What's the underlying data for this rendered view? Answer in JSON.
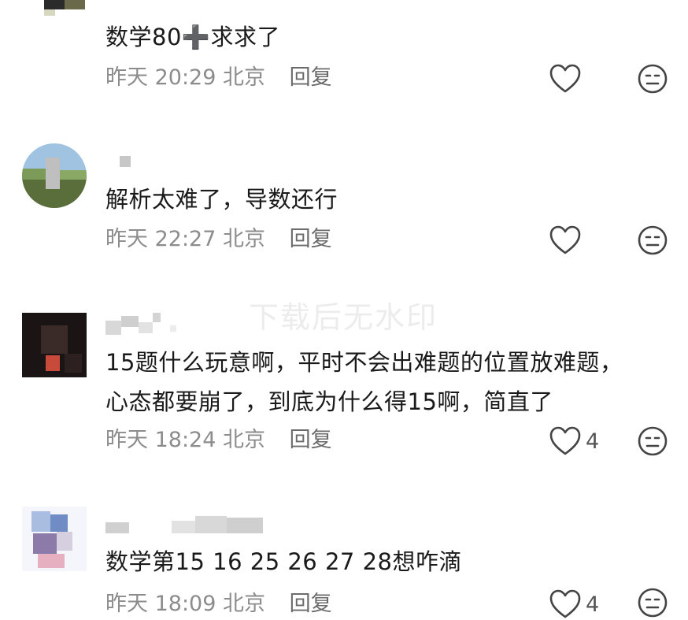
{
  "watermark": "下载后无水印",
  "comments": [
    {
      "text": "数学80➕求求了",
      "time": "昨天 20:29",
      "location": "北京",
      "reply_label": "回复",
      "like_count": ""
    },
    {
      "text": "解析太难了，导数还行",
      "time": "昨天 22:27",
      "location": "北京",
      "reply_label": "回复",
      "like_count": ""
    },
    {
      "text": "15题什么玩意啊，平时不会出难题的位置放难题，\n心态都要崩了，到底为什么得15啊，简直了",
      "time": "昨天 18:24",
      "location": "北京",
      "reply_label": "回复",
      "like_count": "4"
    },
    {
      "text": "数学第15 16 25 26 27 28想咋滴",
      "time": "昨天 18:09",
      "location": "北京",
      "reply_label": "回复",
      "like_count": "4"
    }
  ],
  "icons": {
    "like": "heart-outline-icon",
    "dislike": "meh-face-icon"
  },
  "colors": {
    "text": "#1a1a1a",
    "meta": "#8c8c8c",
    "icon": "#444444"
  }
}
